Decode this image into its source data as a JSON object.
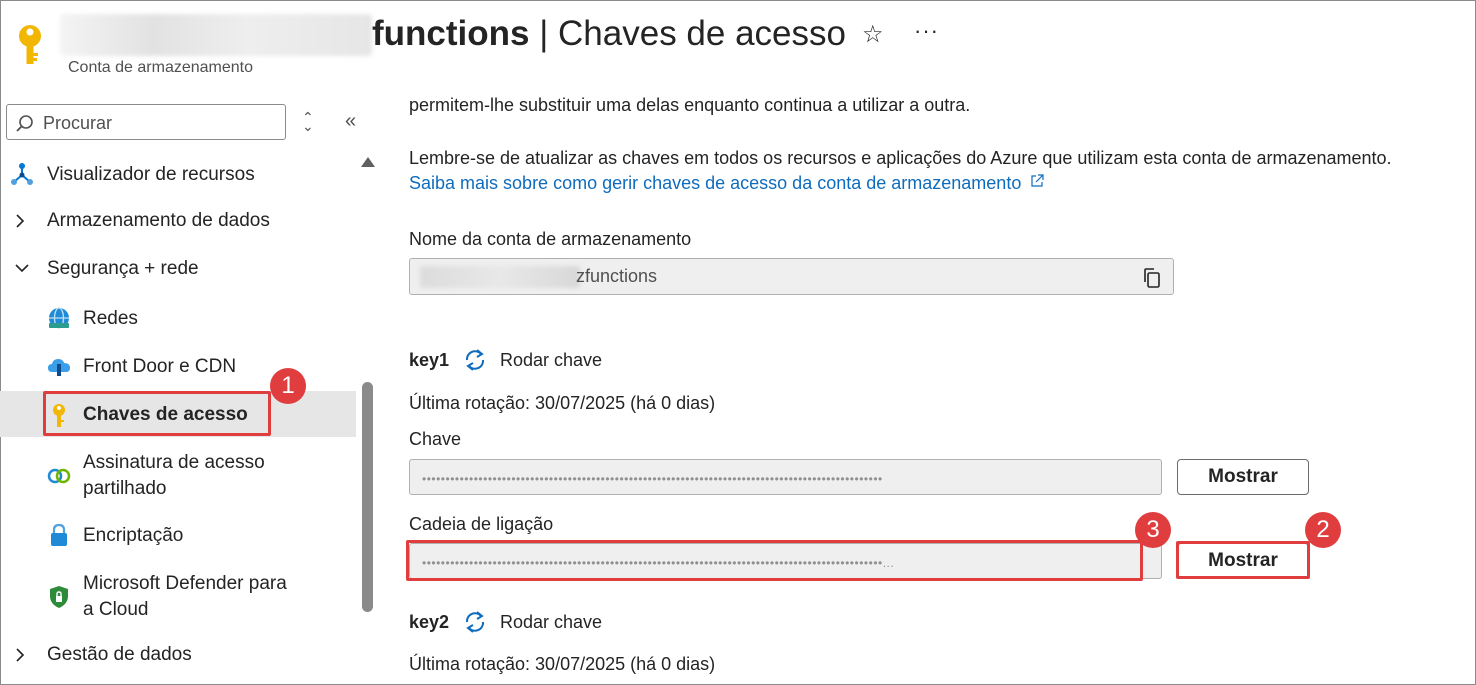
{
  "header": {
    "title_bold": "functions",
    "title_rest": " | Chaves de acesso",
    "subtitle": "Conta de armazenamento",
    "star_icon": "☆",
    "more_icon": "···"
  },
  "sidebar": {
    "search_placeholder": "Procurar",
    "items": [
      {
        "label": "Visualizador de recursos",
        "icon": "resource-visualizer-icon"
      },
      {
        "label": "Armazenamento de dados",
        "expanded": false
      },
      {
        "label": "Segurança + rede",
        "expanded": true
      },
      {
        "label": "Redes",
        "icon": "networking-icon"
      },
      {
        "label": "Front Door e CDN",
        "icon": "front-door-icon"
      },
      {
        "label": "Chaves de acesso",
        "icon": "key-icon",
        "selected": true
      },
      {
        "label": "Assinatura de acesso",
        "label2": "partilhado",
        "icon": "sas-icon"
      },
      {
        "label": "Encriptação",
        "icon": "lock-icon"
      },
      {
        "label": "Microsoft Defender para",
        "label2": "a Cloud",
        "icon": "defender-icon"
      },
      {
        "label": "Gestão de dados",
        "expanded": false
      }
    ]
  },
  "main": {
    "intro_tail": "permitem-lhe substituir uma delas enquanto continua a utilizar a outra.",
    "reminder": "Lembre-se de atualizar as chaves em todos os recursos e aplicações do Azure que utilizam esta conta de armazenamento.",
    "learn_more": "Saiba mais sobre como gerir chaves de acesso da conta de armazenamento",
    "account_name_label": "Nome da conta de armazenamento",
    "account_name_value": "zfunctions",
    "key1": {
      "title": "key1",
      "rotate_label": "Rodar chave",
      "last_rotation": "Última rotação: 30/07/2025 (há 0 dias)",
      "key_label": "Chave",
      "key_value": "••••••••••••••••••••••••••••••••••••••••••••••••••••••••••••••••••••••••••••••••••••••••••••••••••",
      "show_key": "Mostrar",
      "conn_label": "Cadeia de ligação",
      "conn_value": "••••••••••••••••••••••••••••••••••••••••••••••••••••••••••••••••••••••••••••••••••••••••••••••••••...",
      "show_conn": "Mostrar"
    },
    "key2": {
      "title": "key2",
      "rotate_label": "Rodar chave",
      "last_rotation": "Última rotação: 30/07/2025 (há 0 dias)"
    }
  },
  "annotations": [
    "1",
    "2",
    "3"
  ],
  "colors": {
    "accent": "#0f6cbd",
    "annotation": "#e03e3e",
    "selected_bg": "#e6e6e6"
  }
}
